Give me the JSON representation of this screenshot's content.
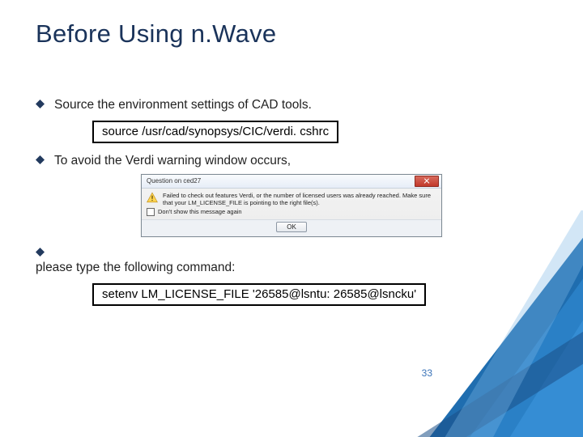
{
  "title": "Before Using n.Wave",
  "bullets": {
    "b1": "Source the environment settings of CAD tools.",
    "code1": "source /usr/cad/synopsys/CIC/verdi. cshrc",
    "b2": "To avoid the Verdi warning window occurs,",
    "b3": "please type the following command:",
    "code2": "setenv LM_LICENSE_FILE '26585@lsntu: 26585@lsncku'"
  },
  "dialog": {
    "title": "Question on ced27",
    "message": "Failed to check out features Verdi, or the number of licensed users was already reached. Make sure that your LM_LICENSE_FILE is pointing to the right file(s).",
    "checkbox": "Don't show this message again",
    "ok": "OK"
  },
  "page_number": "33"
}
